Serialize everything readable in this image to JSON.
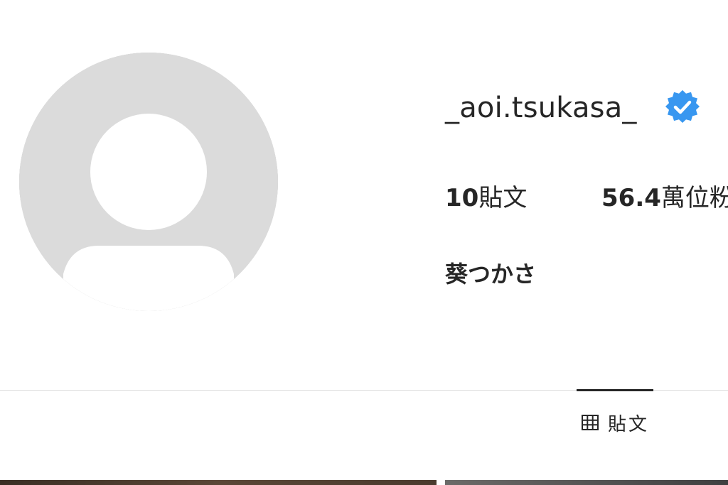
{
  "profile": {
    "username": "_aoi.tsukasa_",
    "verified_icon": "verified-badge-icon",
    "display_name": "葵つかさ",
    "stats": [
      {
        "number": "10",
        "label": "貼文"
      },
      {
        "number": "56.4",
        "label": "萬位粉"
      }
    ]
  },
  "tabs": [
    {
      "icon": "grid-icon",
      "label": "貼文",
      "active": true
    }
  ],
  "colors": {
    "verified": "#3897f0",
    "text": "#262626",
    "avatar_bg": "#dbdbdb",
    "divider": "#dbdbdb"
  }
}
